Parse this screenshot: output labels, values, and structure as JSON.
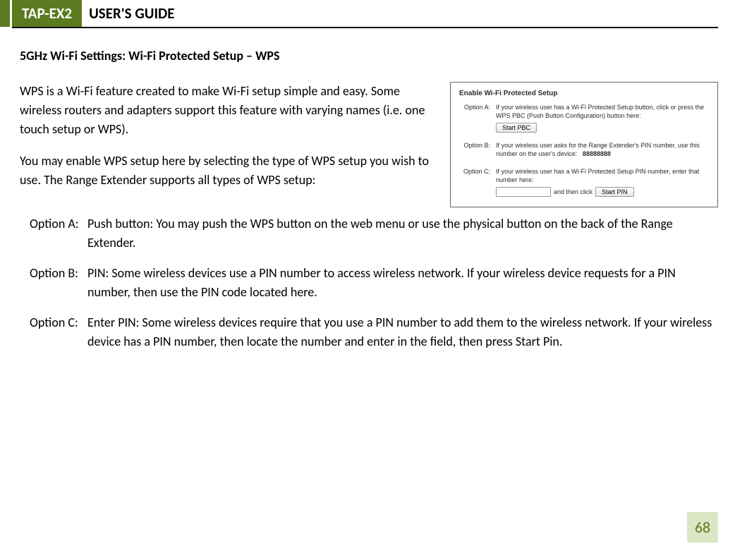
{
  "header": {
    "badge": "TAP-EX2",
    "title": "USER'S GUIDE"
  },
  "section_title": "5GHz Wi-Fi Settings: Wi-Fi Protected Setup – WPS",
  "intro": {
    "p1": "WPS is a Wi-Fi feature created to make Wi-Fi setup simple and easy. Some wireless routers and adapters support this feature with varying names (i.e. one touch setup or WPS).",
    "p2": "You may enable WPS setup here by selecting the type of WPS setup you wish to use. The Range Extender supports all types of WPS setup:"
  },
  "panel": {
    "title": "Enable Wi-Fi Protected Setup",
    "optA_label": "Option A:",
    "optA_text": "If your wireless user has a Wi-Fi Protected Setup button, click or press the WPS PBC (Push Button Configuration) button here:",
    "start_pbc": "Start PBC",
    "optB_label": "Option B:",
    "optB_text": "If your wireless user asks for the Range Extender's PIN number, use this number on the user's device:",
    "pin_value": "88888888",
    "optC_label": "Option C:",
    "optC_text": "If your wireless user has a Wi-Fi Protected Setup PIN number, enter that number here:",
    "then_click": "and then click",
    "start_pin": "Start PIN"
  },
  "options": {
    "a_label": "Option A:",
    "a_text": "Push button: You may push the WPS button on the web menu or use the physical button on the back of the Range Extender.",
    "b_label": "Option B:",
    "b_text": "PIN: Some wireless devices use a PIN number to access wireless network. If your wireless device requests for a PIN number, then use the PIN code located here.",
    "c_label": "Option C:",
    "c_text": "Enter PIN: Some wireless devices require that you use a PIN number to add them to the wireless network. If your wireless device has a PIN number, then locate the number and enter in the field, then press Start Pin."
  },
  "page_number": "68"
}
